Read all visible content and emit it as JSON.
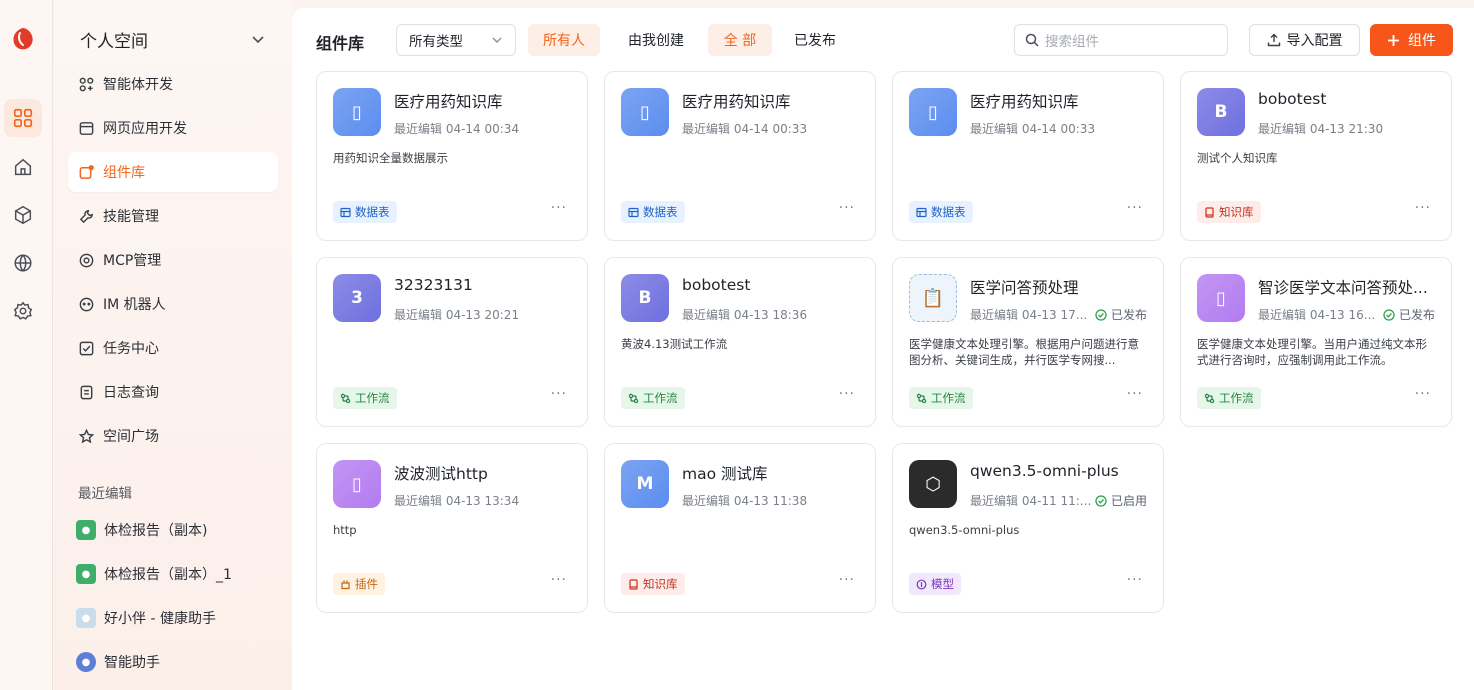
{
  "sidebar": {
    "space_name": "个人空间",
    "menu": [
      {
        "label": "智能体开发",
        "icon": "agent-grid-icon"
      },
      {
        "label": "网页应用开发",
        "icon": "webpage-icon"
      },
      {
        "label": "组件库",
        "icon": "component-icon"
      },
      {
        "label": "技能管理",
        "icon": "wrench-icon"
      },
      {
        "label": "MCP管理",
        "icon": "mcp-icon"
      },
      {
        "label": "IM 机器人",
        "icon": "robot-icon"
      },
      {
        "label": "任务中心",
        "icon": "task-icon"
      },
      {
        "label": "日志查询",
        "icon": "log-icon"
      },
      {
        "label": "空间广场",
        "icon": "star-icon"
      }
    ],
    "active_menu": "组件库",
    "recent_title": "最近编辑",
    "recent": [
      {
        "label": "体检报告（副本)",
        "color": "#3fae6a"
      },
      {
        "label": "体检报告（副本）_1",
        "color": "#3fae6a"
      },
      {
        "label": "好小伴 - 健康助手",
        "color": "#8fb7d9"
      },
      {
        "label": "智能助手",
        "color": "#5d7fd6"
      }
    ]
  },
  "toolbar": {
    "title": "组件库",
    "type_select": "所有类型",
    "owner_all": "所有人",
    "owner_mine": "由我创建",
    "status_all": "全 部",
    "status_published": "已发布",
    "search_placeholder": "搜索组件",
    "import_label": "导入配置",
    "add_label": "组件"
  },
  "cards": [
    {
      "name": "医疗用药知识库",
      "meta": "最近编辑 04-14 00:34",
      "status": "",
      "desc": "用药知识全量数据展示",
      "tag": "数据表",
      "tag_type": "blue",
      "icon_text": "▯",
      "icon_color": "#5b8def"
    },
    {
      "name": "医疗用药知识库",
      "meta": "最近编辑 04-14 00:33",
      "status": "",
      "desc": "",
      "tag": "数据表",
      "tag_type": "blue",
      "icon_text": "▯",
      "icon_color": "#5b8def"
    },
    {
      "name": "医疗用药知识库",
      "meta": "最近编辑 04-14 00:33",
      "status": "",
      "desc": "",
      "tag": "数据表",
      "tag_type": "blue",
      "icon_text": "▯",
      "icon_color": "#5b8def"
    },
    {
      "name": "bobotest",
      "meta": "最近编辑 04-13 21:30",
      "status": "",
      "desc": "测试个人知识库",
      "tag": "知识库",
      "tag_type": "red",
      "icon_text": "B",
      "icon_color": "#6f6fe0"
    },
    {
      "name": "32323131",
      "meta": "最近编辑 04-13 20:21",
      "status": "",
      "desc": "",
      "tag": "工作流",
      "tag_type": "green",
      "icon_text": "3",
      "icon_color": "#6f6fe0"
    },
    {
      "name": "bobotest",
      "meta": "最近编辑 04-13 18:36",
      "status": "",
      "desc": "黄波4.13测试工作流",
      "tag": "工作流",
      "tag_type": "green",
      "icon_text": "B",
      "icon_color": "#6f6fe0"
    },
    {
      "name": "医学问答预处理",
      "meta": "最近编辑 04-13 17...",
      "status": "已发布",
      "desc": "医学健康文本处理引擎。根据用户问题进行意图分析、关键词生成，并行医学专网搜...",
      "tag": "工作流",
      "tag_type": "green",
      "icon_text": "📋",
      "icon_color": "#e9f1fb"
    },
    {
      "name": "智诊医学文本问答预处...",
      "meta": "最近编辑 04-13 16...",
      "status": "已发布",
      "desc": "医学健康文本处理引擎。当用户通过纯文本形式进行咨询时，应强制调用此工作流。",
      "tag": "工作流",
      "tag_type": "green",
      "icon_text": "▯",
      "icon_color": "#b37bf0"
    },
    {
      "name": "波波测试http",
      "meta": "最近编辑 04-13 13:34",
      "status": "",
      "desc": "http",
      "tag": "插件",
      "tag_type": "orange",
      "icon_text": "▯",
      "icon_color": "#b37bf0"
    },
    {
      "name": "mao 测试库",
      "meta": "最近编辑 04-13 11:38",
      "status": "",
      "desc": "",
      "tag": "知识库",
      "tag_type": "red",
      "icon_text": "M",
      "icon_color": "#5b8def"
    },
    {
      "name": "qwen3.5-omni-plus",
      "meta": "最近编辑 04-11 11:...",
      "status": "已启用",
      "desc": "qwen3.5-omni-plus",
      "tag": "模型",
      "tag_type": "purple",
      "icon_text": "⬡",
      "icon_color": "#2b2b2b"
    }
  ],
  "more_label": "···",
  "colors": {
    "accent": "#f7551a",
    "accent_soft": "#fdeee6"
  }
}
